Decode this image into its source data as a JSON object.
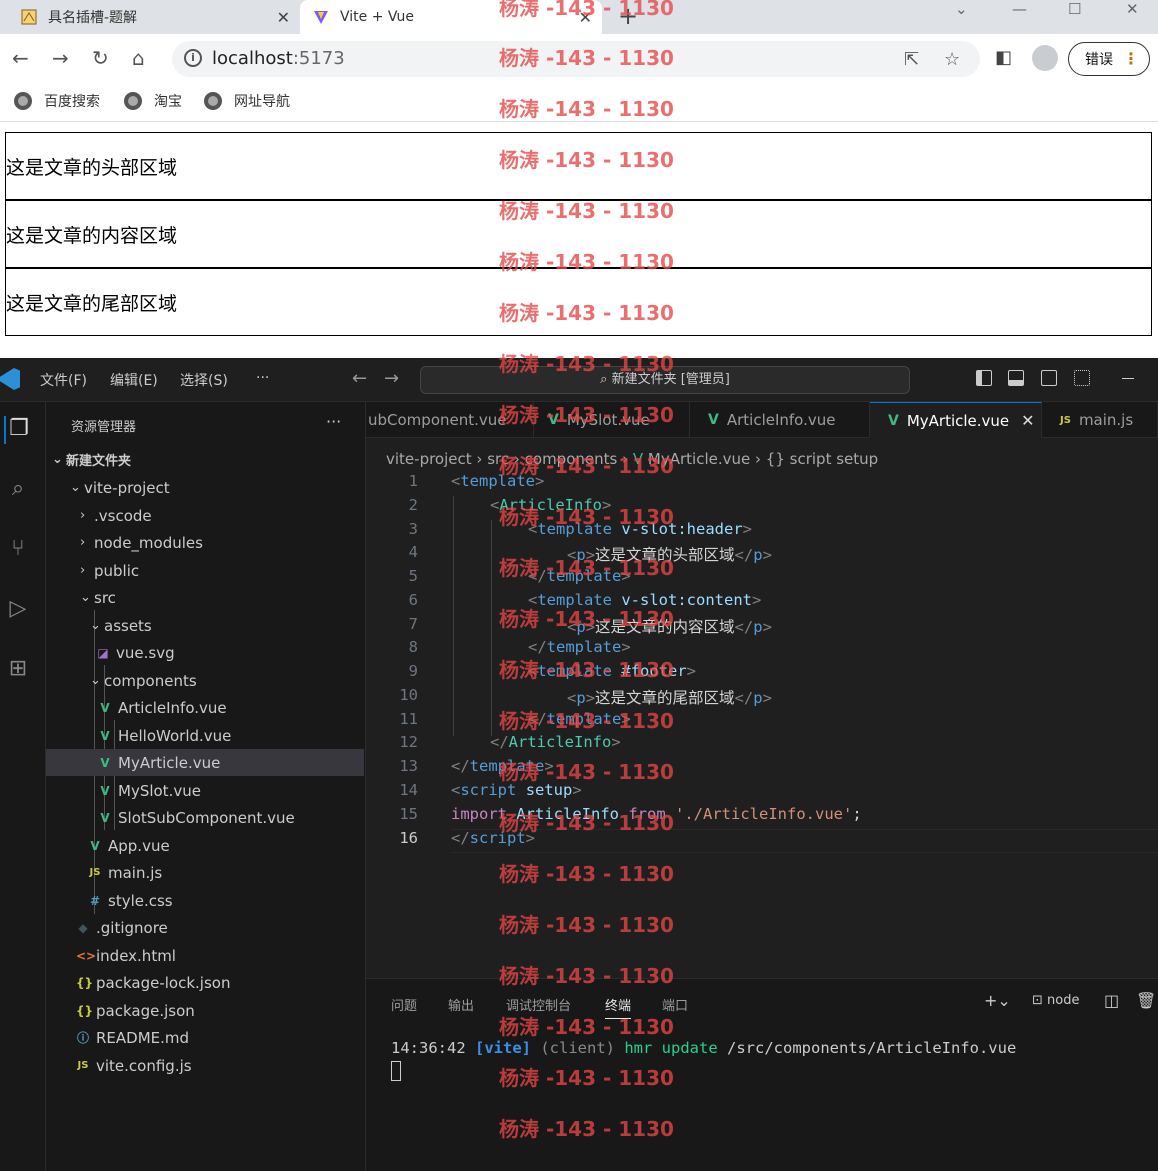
{
  "browser": {
    "tabs": [
      {
        "title": "具名插槽-题解",
        "active": false
      },
      {
        "title": "Vite + Vue",
        "active": true
      }
    ],
    "url": {
      "host": "localhost",
      "port": ":5173"
    },
    "error_button": "错误",
    "bookmarks": [
      "百度搜索",
      "淘宝",
      "网址导航"
    ]
  },
  "page": {
    "sections": [
      "这是文章的头部区域",
      "这是文章的内容区域",
      "这是文章的尾部区域"
    ]
  },
  "vscode": {
    "menu": [
      "文件(F)",
      "编辑(E)",
      "选择(S)",
      "···"
    ],
    "command_center": "新建文件夹 [管理员]",
    "explorer_title": "资源管理器",
    "tree": [
      {
        "label": "新建文件夹",
        "kind": "root"
      },
      {
        "label": "vite-project",
        "kind": "folder-open"
      },
      {
        "label": ".vscode",
        "kind": "folder"
      },
      {
        "label": "node_modules",
        "kind": "folder"
      },
      {
        "label": "public",
        "kind": "folder"
      },
      {
        "label": "src",
        "kind": "folder-open"
      },
      {
        "label": "assets",
        "kind": "folder-open"
      },
      {
        "label": "vue.svg",
        "kind": "svg"
      },
      {
        "label": "components",
        "kind": "folder-open"
      },
      {
        "label": "ArticleInfo.vue",
        "kind": "vue"
      },
      {
        "label": "HelloWorld.vue",
        "kind": "vue"
      },
      {
        "label": "MyArticle.vue",
        "kind": "vue",
        "selected": true
      },
      {
        "label": "MySlot.vue",
        "kind": "vue"
      },
      {
        "label": "SlotSubComponent.vue",
        "kind": "vue"
      },
      {
        "label": "App.vue",
        "kind": "vue"
      },
      {
        "label": "main.js",
        "kind": "js"
      },
      {
        "label": "style.css",
        "kind": "css"
      },
      {
        "label": ".gitignore",
        "kind": "git"
      },
      {
        "label": "index.html",
        "kind": "html"
      },
      {
        "label": "package-lock.json",
        "kind": "json"
      },
      {
        "label": "package.json",
        "kind": "json"
      },
      {
        "label": "README.md",
        "kind": "info"
      },
      {
        "label": "vite.config.js",
        "kind": "js"
      }
    ],
    "editor_tabs": [
      {
        "label": "ubComponent.vue",
        "kind": "none"
      },
      {
        "label": "MySlot.vue",
        "kind": "vue"
      },
      {
        "label": "ArticleInfo.vue",
        "kind": "vue"
      },
      {
        "label": "MyArticle.vue",
        "kind": "vue",
        "active": true
      },
      {
        "label": "main.js",
        "kind": "js"
      }
    ],
    "breadcrumb": [
      "vite-project",
      "src",
      "components",
      "MyArticle.vue",
      "{} script setup"
    ],
    "line_numbers": [
      "1",
      "2",
      "3",
      "4",
      "5",
      "6",
      "7",
      "8",
      "9",
      "10",
      "11",
      "12",
      "13",
      "14",
      "15",
      "16"
    ],
    "code": {
      "l1": {
        "a": "<",
        "b": "template",
        "c": ">"
      },
      "l2": {
        "a": "<",
        "b": "ArticleInfo",
        "c": ">"
      },
      "l3": {
        "a": "<",
        "b": "template",
        "c": "v-slot:header",
        "d": ">"
      },
      "l4": {
        "a": "<",
        "b": "p",
        "c": ">",
        "d": "这是文章的头部区域",
        "e": "</",
        "f": "p",
        "g": ">"
      },
      "l5": {
        "a": "</",
        "b": "template",
        "c": ">"
      },
      "l6": {
        "a": "<",
        "b": "template",
        "c": "v-slot:content",
        "d": ">"
      },
      "l7": {
        "a": "<",
        "b": "p",
        "c": ">",
        "d": "这是文章的内容区域",
        "e": "</",
        "f": "p",
        "g": ">"
      },
      "l8": {
        "a": "</",
        "b": "template",
        "c": ">"
      },
      "l9": {
        "a": "<",
        "b": "template",
        "c": "#footer",
        "d": ">"
      },
      "l10": {
        "a": "<",
        "b": "p",
        "c": ">",
        "d": "这是文章的尾部区域",
        "e": "</",
        "f": "p",
        "g": ">"
      },
      "l11": {
        "a": "</",
        "b": "template",
        "c": ">"
      },
      "l12": {
        "a": "</",
        "b": "ArticleInfo",
        "c": ">"
      },
      "l13": {
        "a": "</",
        "b": "template",
        "c": ">"
      },
      "l14": {
        "a": "<",
        "b": "script",
        "c": "setup",
        "d": ">"
      },
      "l15": {
        "a": "import",
        "b": "ArticleInfo",
        "c": "from",
        "d": "'./ArticleInfo.vue'",
        "e": ";"
      },
      "l16": {
        "a": "</",
        "b": "script",
        "c": ">"
      }
    },
    "panel_tabs": [
      "问题",
      "输出",
      "调试控制台",
      "终端",
      "端口"
    ],
    "terminal_name": "node",
    "terminal": {
      "time": "14:36:42",
      "tag": "[vite]",
      "client": "(client)",
      "hmr": "hmr update",
      "path": "/src/components/ArticleInfo.vue"
    }
  },
  "watermark": "杨涛 -143 - 1130",
  "colors": {
    "accent": "#0078d4",
    "vue": "#41b883",
    "watermark": "#e64646"
  }
}
